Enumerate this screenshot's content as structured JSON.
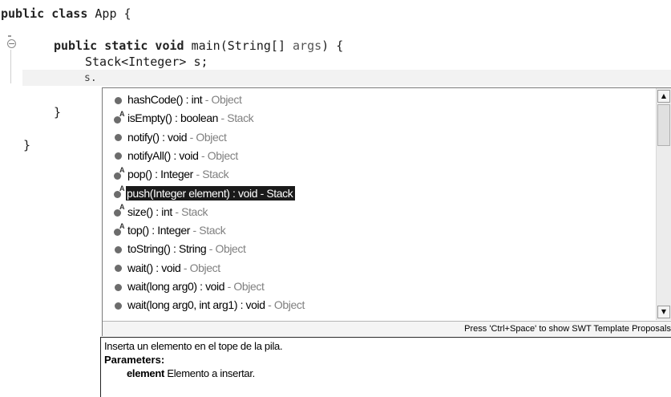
{
  "editor": {
    "lines": {
      "class_kw": "public class",
      "class_name": " App {",
      "method_kw": "public static void",
      "method_rest": " main(String[] ",
      "method_args": "args",
      "method_end": ") {",
      "stack_decl": "Stack<Integer> s;",
      "current_input": "s.",
      "close_method": "}",
      "close_class": "}"
    }
  },
  "completion": {
    "items": [
      {
        "sig": "hashCode() : int",
        "decl": " - Object",
        "icon": "public-method-icon"
      },
      {
        "sig": "isEmpty() : boolean",
        "decl": " - Stack",
        "icon": "abstract-method-icon"
      },
      {
        "sig": "notify() : void",
        "decl": " - Object",
        "icon": "public-method-icon"
      },
      {
        "sig": "notifyAll() : void",
        "decl": " - Object",
        "icon": "public-method-icon"
      },
      {
        "sig": "pop() : Integer",
        "decl": " - Stack",
        "icon": "abstract-method-icon"
      },
      {
        "sig": "push(Integer element) : void",
        "decl": " - Stack",
        "icon": "abstract-method-icon",
        "selected": true
      },
      {
        "sig": "size() : int",
        "decl": " - Stack",
        "icon": "abstract-method-icon"
      },
      {
        "sig": "top() : Integer",
        "decl": " - Stack",
        "icon": "abstract-method-icon"
      },
      {
        "sig": "toString() : String",
        "decl": " - Object",
        "icon": "public-method-icon"
      },
      {
        "sig": "wait() : void",
        "decl": " - Object",
        "icon": "public-method-icon"
      },
      {
        "sig": "wait(long arg0) : void",
        "decl": " - Object",
        "icon": "public-method-icon"
      },
      {
        "sig": "wait(long arg0, int arg1) : void",
        "decl": " - Object",
        "icon": "public-method-icon"
      }
    ],
    "status": "Press 'Ctrl+Space' to show SWT Template Proposals",
    "abstract_marker": "A"
  },
  "info": {
    "description": "Inserta un elemento en el tope de la pila.",
    "params_label": "Parameters:",
    "param_name": "element",
    "param_desc": " Elemento a insertar."
  },
  "colors": {
    "selection_bg": "#1a1a1a",
    "declaring_type": "#808080"
  }
}
